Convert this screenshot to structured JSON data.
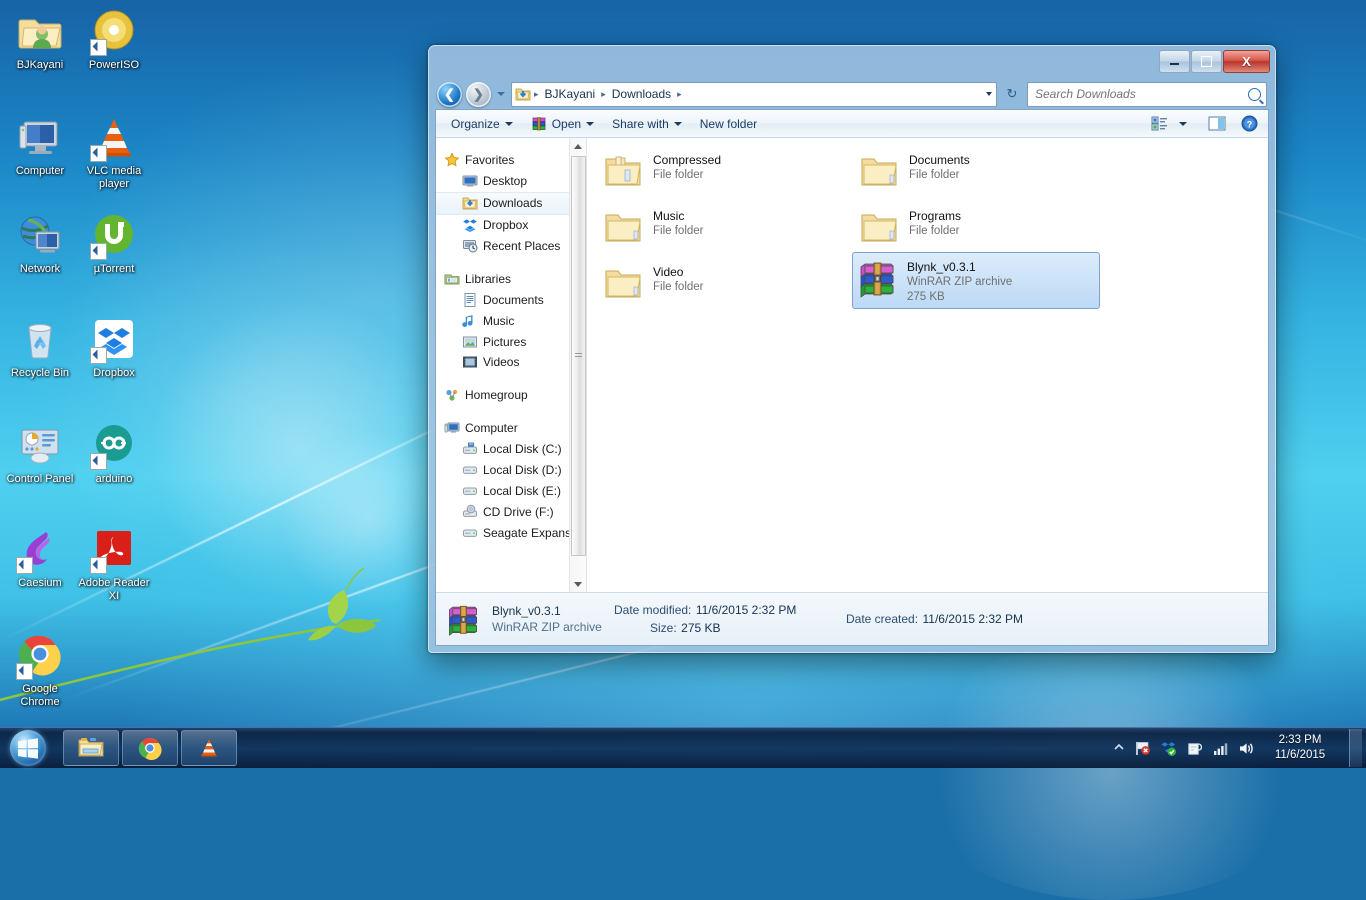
{
  "desktop": {
    "icons": [
      {
        "label": "BJKayani",
        "icon": "user-folder-icon",
        "shortcut": false
      },
      {
        "label": "PowerISO",
        "icon": "disc-icon",
        "shortcut": true
      },
      {
        "label": "Computer",
        "icon": "computer-icon",
        "shortcut": false
      },
      {
        "label": "VLC media player",
        "icon": "vlc-cone-icon",
        "shortcut": true
      },
      {
        "label": "Network",
        "icon": "network-globe-icon",
        "shortcut": false
      },
      {
        "label": "µTorrent",
        "icon": "utorrent-icon",
        "shortcut": true
      },
      {
        "label": "Recycle Bin",
        "icon": "recycle-bin-icon",
        "shortcut": false
      },
      {
        "label": "Dropbox",
        "icon": "dropbox-icon",
        "shortcut": true
      },
      {
        "label": "Control Panel",
        "icon": "control-panel-icon",
        "shortcut": false
      },
      {
        "label": "arduino",
        "icon": "arduino-infinity-icon",
        "shortcut": true
      },
      {
        "label": "Caesium",
        "icon": "caesium-bird-icon",
        "shortcut": true
      },
      {
        "label": "Adobe Reader XI",
        "icon": "adobe-reader-icon",
        "shortcut": true
      },
      {
        "label": "Google Chrome",
        "icon": "chrome-icon",
        "shortcut": true
      }
    ]
  },
  "window": {
    "title": "",
    "controls": {
      "minimize": "–",
      "maximize": "□",
      "close": "X"
    },
    "address": {
      "back_tooltip": "Back",
      "forward_tooltip": "Forward",
      "crumbs": [
        "BJKayani",
        "Downloads"
      ],
      "separator": "▸",
      "refresh_icon": "refresh-icon"
    },
    "search": {
      "placeholder": "Search Downloads",
      "value": "",
      "icon": "search-icon"
    },
    "toolbar": {
      "organize": "Organize",
      "open": "Open",
      "share_with": "Share with",
      "new_folder": "New folder",
      "view_icon": "view-layout-icon",
      "preview_icon": "preview-pane-icon",
      "help_icon": "help-icon",
      "help_glyph": "?"
    },
    "navpane": {
      "groups": [
        {
          "header": {
            "label": "Favorites",
            "icon": "favorites-star-icon"
          },
          "items": [
            {
              "label": "Desktop",
              "icon": "desktop-icon",
              "selected": false
            },
            {
              "label": "Downloads",
              "icon": "downloads-folder-icon",
              "selected": true
            },
            {
              "label": "Dropbox",
              "icon": "dropbox-icon",
              "selected": false
            },
            {
              "label": "Recent Places",
              "icon": "recent-places-icon",
              "selected": false
            }
          ]
        },
        {
          "header": {
            "label": "Libraries",
            "icon": "libraries-icon"
          },
          "items": [
            {
              "label": "Documents",
              "icon": "documents-library-icon",
              "selected": false
            },
            {
              "label": "Music",
              "icon": "music-library-icon",
              "selected": false
            },
            {
              "label": "Pictures",
              "icon": "pictures-library-icon",
              "selected": false
            },
            {
              "label": "Videos",
              "icon": "videos-library-icon",
              "selected": false
            }
          ]
        },
        {
          "header": {
            "label": "Homegroup",
            "icon": "homegroup-icon"
          },
          "items": []
        },
        {
          "header": {
            "label": "Computer",
            "icon": "computer-icon"
          },
          "items": [
            {
              "label": "Local Disk (C:)",
              "icon": "system-drive-icon",
              "selected": false
            },
            {
              "label": "Local Disk (D:)",
              "icon": "drive-icon",
              "selected": false
            },
            {
              "label": "Local Disk (E:)",
              "icon": "drive-icon",
              "selected": false
            },
            {
              "label": "CD Drive (F:)",
              "icon": "cd-drive-icon",
              "selected": false
            },
            {
              "label": "Seagate Expansio",
              "icon": "drive-icon",
              "selected": false
            }
          ]
        }
      ]
    },
    "files": [
      {
        "name": "Compressed",
        "type": "File folder",
        "size": "",
        "icon": "folder-open-icon",
        "selected": false
      },
      {
        "name": "Documents",
        "type": "File folder",
        "size": "",
        "icon": "folder-icon",
        "selected": false
      },
      {
        "name": "Music",
        "type": "File folder",
        "size": "",
        "icon": "folder-icon",
        "selected": false
      },
      {
        "name": "Programs",
        "type": "File folder",
        "size": "",
        "icon": "folder-icon",
        "selected": false
      },
      {
        "name": "Video",
        "type": "File folder",
        "size": "",
        "icon": "folder-icon",
        "selected": false
      },
      {
        "name": "Blynk_v0.3.1",
        "type": "WinRAR ZIP archive",
        "size": "275 KB",
        "icon": "winrar-archive-icon",
        "selected": true
      }
    ],
    "statusbar": {
      "name": "Blynk_v0.3.1",
      "type": "WinRAR ZIP archive",
      "icon": "winrar-archive-icon",
      "date_modified_label": "Date modified:",
      "date_modified_value": "11/6/2015 2:32 PM",
      "size_label": "Size:",
      "size_value": "275 KB",
      "date_created_label": "Date created:",
      "date_created_value": "11/6/2015 2:32 PM"
    }
  },
  "taskbar": {
    "start_tooltip": "Start",
    "buttons": [
      {
        "name": "windows-explorer-taskbar-button",
        "icon": "explorer-folder-icon"
      },
      {
        "name": "chrome-taskbar-button",
        "icon": "chrome-icon"
      },
      {
        "name": "vlc-taskbar-button",
        "icon": "vlc-cone-icon"
      }
    ],
    "tray": {
      "show_hidden_icon": "chevron-up-icon",
      "icons": [
        "network-flag-icon",
        "dropbox-icon",
        "action-center-icon",
        "network-signal-icon",
        "volume-icon"
      ],
      "time": "2:33 PM",
      "date": "11/6/2015"
    }
  },
  "colors": {
    "accent": "#1f6bb0",
    "selection": "#bcd9f5",
    "selection_border": "#7da2ce",
    "close_button": "#d8544a",
    "desktop_top": "#1763a6",
    "desktop_bottom": "#0d4e88"
  }
}
